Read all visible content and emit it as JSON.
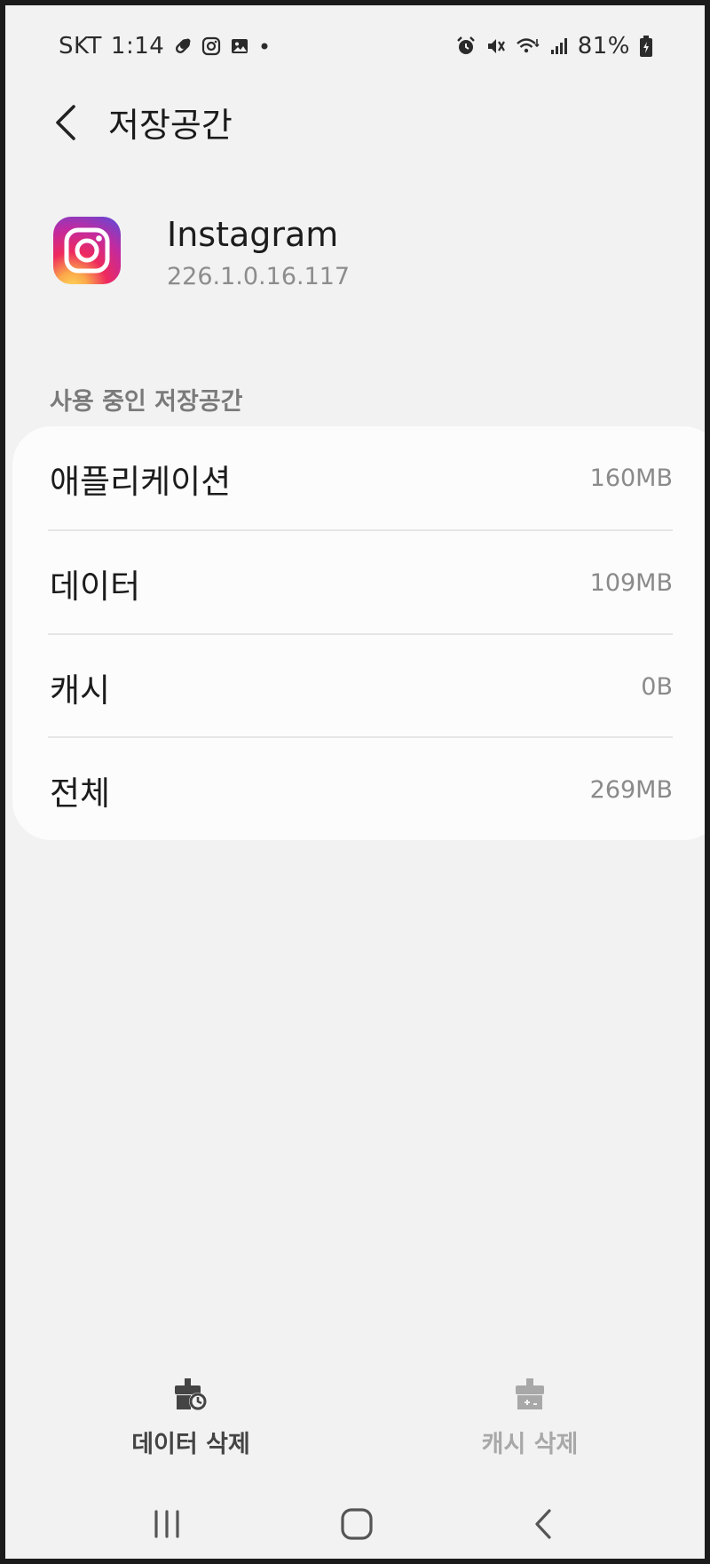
{
  "status_bar": {
    "carrier": "SKT",
    "time": "1:14",
    "battery": "81%"
  },
  "header": {
    "title": "저장공간"
  },
  "app": {
    "name": "Instagram",
    "version": "226.1.0.16.117"
  },
  "storage": {
    "section_label": "사용 중인 저장공간",
    "rows": [
      {
        "label": "애플리케이션",
        "value": "160MB"
      },
      {
        "label": "데이터",
        "value": "109MB"
      },
      {
        "label": "캐시",
        "value": "0B"
      },
      {
        "label": "전체",
        "value": "269MB"
      }
    ]
  },
  "actions": {
    "clear_data": {
      "label": "데이터 삭제",
      "enabled": true
    },
    "clear_cache": {
      "label": "캐시 삭제",
      "enabled": false
    }
  },
  "colors": {
    "background": "#f2f2f2",
    "card": "#fcfcfc",
    "text_primary": "#1c1c1c",
    "text_secondary": "#8a8a8a",
    "action_enabled": "#444444",
    "action_disabled": "#a8a8a8"
  },
  "icons": {
    "status": [
      "pill-icon",
      "instagram-icon",
      "gallery-icon",
      "dot-icon",
      "alarm-icon",
      "mute-icon",
      "wifi-icon",
      "signal-icon",
      "battery-icon"
    ],
    "nav": [
      "recents-icon",
      "home-icon",
      "back-icon"
    ]
  }
}
